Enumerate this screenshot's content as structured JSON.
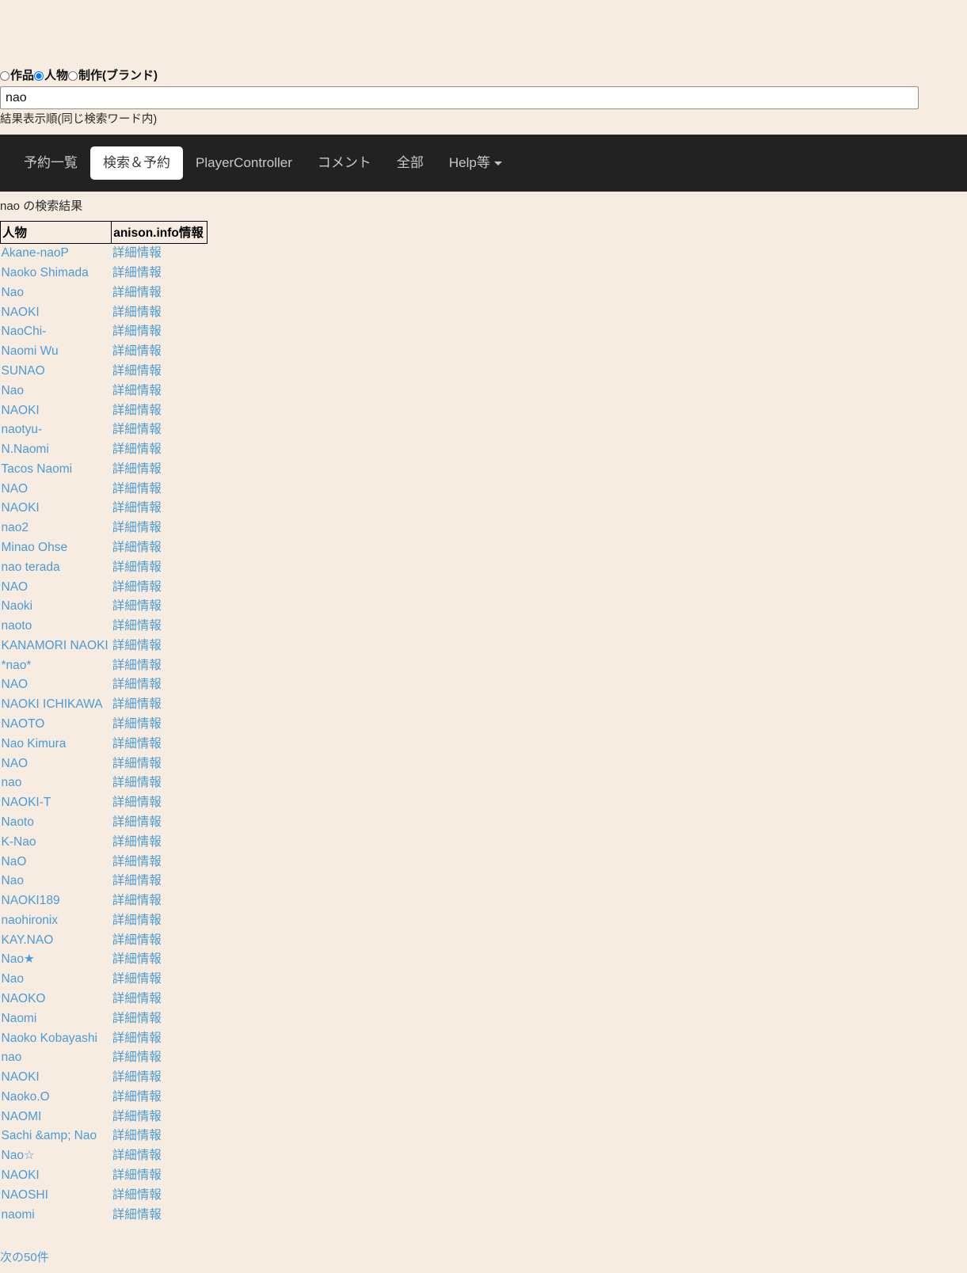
{
  "search_form": {
    "radios": [
      {
        "label": "作品",
        "checked": false,
        "name": "radio-sakuhin"
      },
      {
        "label": "人物",
        "checked": true,
        "name": "radio-jinbutsu"
      },
      {
        "label": "制作(ブランド)",
        "checked": false,
        "name": "radio-seisaku"
      }
    ],
    "query_value": "nao",
    "query_placeholder": "",
    "order_label": "結果表示順(同じ検索ワード内)"
  },
  "navbar": {
    "items": [
      {
        "label": "予約一覧",
        "active": false,
        "caret": false
      },
      {
        "label": "検索＆予約",
        "active": true,
        "caret": false
      },
      {
        "label": "PlayerController",
        "active": false,
        "caret": false
      },
      {
        "label": "コメント",
        "active": false,
        "caret": false
      },
      {
        "label": "全部",
        "active": false,
        "caret": false
      },
      {
        "label": "Help等",
        "active": false,
        "caret": true
      }
    ]
  },
  "results": {
    "heading": "nao の検索結果",
    "columns": [
      "人物",
      "anison.info情報"
    ],
    "detail_label": "詳細情報",
    "rows": [
      "Akane-naoP",
      "Naoko Shimada",
      "Nao",
      "NAOKI",
      "NaoChi-",
      "Naomi Wu",
      "SUNAO",
      "Nao",
      "NAOKI",
      "naotyu-",
      "N.Naomi",
      "Tacos Naomi",
      "NAO",
      "NAOKI",
      "nao2",
      "Minao Ohse",
      "nao terada",
      "NAO",
      "Naoki",
      "naoto",
      "KANAMORI NAOKI",
      "*nao*",
      "NAO",
      "NAOKI ICHIKAWA",
      "NAOTO",
      "Nao Kimura",
      "NAO",
      "nao",
      "NAOKI-T",
      "Naoto",
      "K-Nao",
      "NaO",
      "Nao",
      "NAOKI189",
      "naohironix",
      "KAY.NAO",
      "Nao★",
      "Nao",
      "NAOKO",
      "Naomi",
      "Naoko Kobayashi",
      "nao",
      "NAOKI",
      "Naoko.O",
      "NAOMI",
      "Sachi &amp; Nao",
      "Nao☆",
      "NAOKI",
      "NAOSHI",
      "naomi"
    ]
  },
  "pager": {
    "next_label": "次の50件"
  },
  "colors": {
    "page_background": "#f7ece1",
    "navbar_background": "#222222",
    "link": "#4c9bd4",
    "active_tab_background": "#ffffff",
    "input_background": "#ffffff"
  }
}
